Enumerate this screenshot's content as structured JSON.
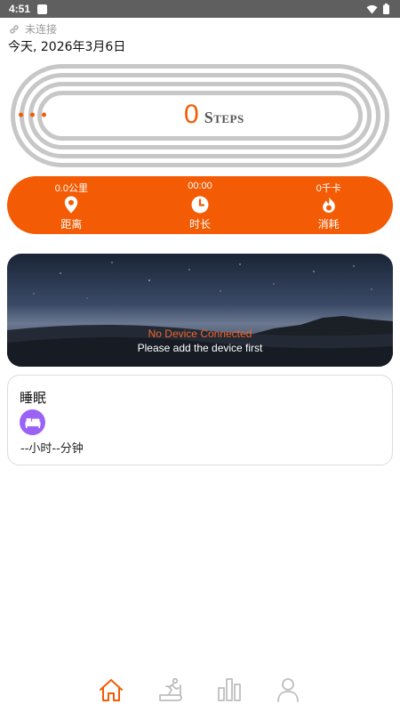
{
  "status_bar": {
    "time": "4:51"
  },
  "connection": {
    "status": "未连接"
  },
  "date": {
    "text": "今天, 2026年3月6日"
  },
  "steps": {
    "value": "0",
    "unit": "Steps"
  },
  "stats": [
    {
      "value": "0.0公里",
      "label": "距离",
      "icon": "location-pin-icon"
    },
    {
      "value": "00:00",
      "label": "时长",
      "icon": "clock-icon"
    },
    {
      "value": "0千卡",
      "label": "消耗",
      "icon": "flame-icon"
    }
  ],
  "device_card": {
    "title": "No Device Connected",
    "subtitle": "Please add the device first"
  },
  "sleep": {
    "title": "睡眠",
    "value": "--小时--分钟",
    "icon": "bed-icon"
  },
  "nav": [
    {
      "name": "home",
      "icon": "home-icon",
      "active": true
    },
    {
      "name": "treadmill",
      "icon": "treadmill-icon",
      "active": false
    },
    {
      "name": "stats",
      "icon": "bar-chart-icon",
      "active": false
    },
    {
      "name": "profile",
      "icon": "person-icon",
      "active": false
    }
  ],
  "colors": {
    "accent": "#f35b04",
    "status_bar": "#5f5f5f",
    "sleep_icon": "#9b63f5",
    "nav_inactive": "#bdbdbd"
  }
}
